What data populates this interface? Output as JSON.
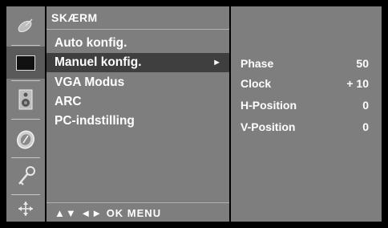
{
  "rail": {
    "icons": [
      {
        "name": "satellite-dish-icon"
      },
      {
        "name": "monitor-icon"
      },
      {
        "name": "speaker-icon"
      },
      {
        "name": "clock-icon"
      },
      {
        "name": "key-icon"
      },
      {
        "name": "network-icon"
      }
    ]
  },
  "menu": {
    "title": "SKÆRM",
    "items": [
      {
        "label": "Auto konfig."
      },
      {
        "label": "Manuel konfig."
      },
      {
        "label": "VGA Modus"
      },
      {
        "label": "ARC"
      },
      {
        "label": "PC-indstilling"
      }
    ],
    "selected_arrow": "►",
    "footer": "▲▼ ◄► OK MENU"
  },
  "sub": {
    "rows": [
      {
        "label": "Phase",
        "value": "50"
      },
      {
        "label": "Clock",
        "value": "+ 10"
      },
      {
        "label": "H-Position",
        "value": "0"
      },
      {
        "label": "V-Position",
        "value": "0"
      }
    ]
  }
}
